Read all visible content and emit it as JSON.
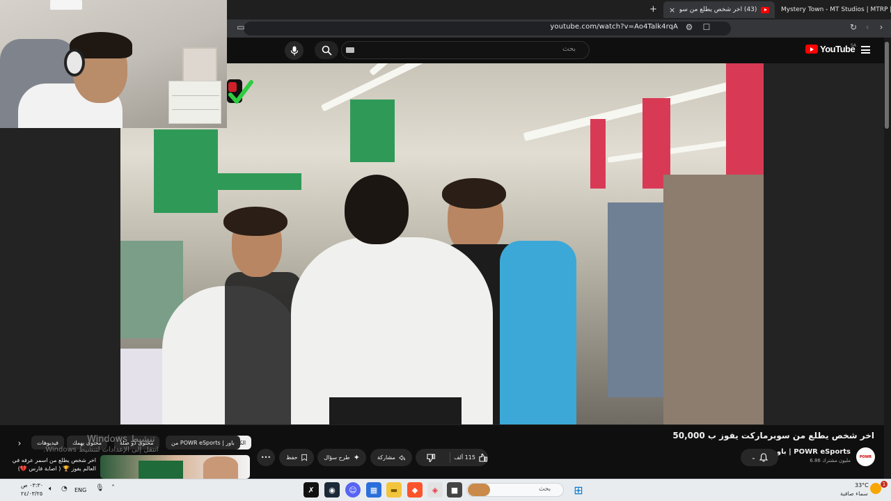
{
  "browser": {
    "tabs": [
      {
        "title": "Mystery Town - MT Studios | MTRP |",
        "active": false
      },
      {
        "title": "(43) اخر شخص يطلع من سوبر...",
        "active": true
      }
    ],
    "new_tab": "+",
    "close_tab": "×",
    "url": "youtube.com/watch?v=Ao4Talk4rqA"
  },
  "youtube": {
    "logo_text": "YouTube",
    "region": "SA",
    "search_placeholder": "بحث"
  },
  "video": {
    "title": "اخر شخص يطلع من سوبرماركت يفوز ب 50,000",
    "channel_name": "POWR eSports | باور",
    "subscribers": "6.86 مليون مشترك",
    "channel_avatar_text": "POWR",
    "likes": "115 ألف",
    "share_label": "مشاركة",
    "ask_label": "طرح سؤال",
    "save_label": "حفظ",
    "more_label": "•••"
  },
  "chips": {
    "all": "الكل",
    "from_channel": "من POWR eSports | باور",
    "related": "محتوى ذو صلة",
    "interest": "محتوى يهمك",
    "videos": "فيديوهات"
  },
  "recommendation": {
    "title": "اخر شخص يطلع من اسمر عرفه في العالم يفوز 🏆 ( اصابة فارس 💔)"
  },
  "watermark": {
    "line1": "Windows تنشيط",
    "line2": "انتقل إلى الإعدادات لتنشيط Windows."
  },
  "taskbar": {
    "time": "٠٣:٣٠ ص",
    "date": "٢٤/٠٣/٢٥",
    "language": "ENG",
    "search_placeholder": "بحث",
    "temperature": "33°C",
    "weather": "سماء صافية",
    "notifications": "1"
  },
  "colors": {
    "yt_red": "#ff0000",
    "dark_bg": "#0f0f0f",
    "pill_bg": "#272727",
    "taskbar_bg": "#e9ecef"
  }
}
